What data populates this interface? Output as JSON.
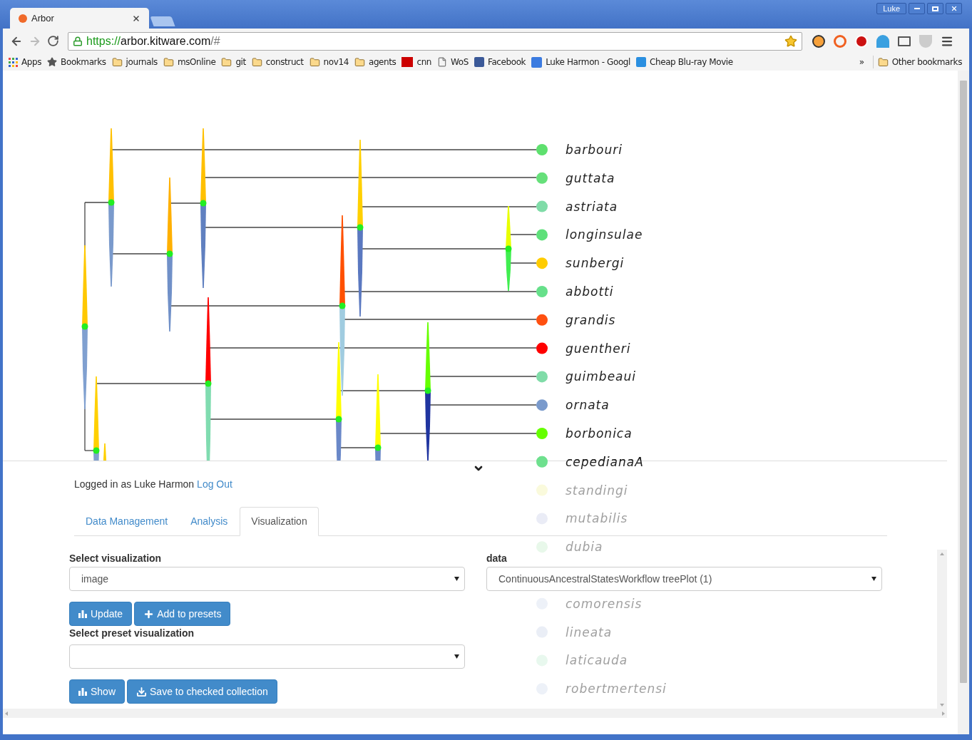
{
  "browser": {
    "tab_title": "Arbor",
    "profile": "Luke",
    "url_scheme": "https://",
    "url_host": "arbor.kitware.com",
    "url_path": "/#"
  },
  "bookmarks": [
    {
      "label": "Apps",
      "kind": "apps"
    },
    {
      "label": "Bookmarks",
      "kind": "star"
    },
    {
      "label": "journals",
      "kind": "folder"
    },
    {
      "label": "msOnline",
      "kind": "folder"
    },
    {
      "label": "git",
      "kind": "folder"
    },
    {
      "label": "construct",
      "kind": "folder"
    },
    {
      "label": "nov14",
      "kind": "folder"
    },
    {
      "label": "agents",
      "kind": "folder"
    },
    {
      "label": "cnn",
      "kind": "news"
    },
    {
      "label": "WoS",
      "kind": "page"
    },
    {
      "label": "Facebook",
      "kind": "social"
    },
    {
      "label": "Luke Harmon - Googl",
      "kind": "search"
    },
    {
      "label": "Cheap Blu-ray Movie",
      "kind": "blog"
    }
  ],
  "bookmarks_overflow": "»",
  "other_bookmarks": "Other bookmarks",
  "tree": {
    "tips": [
      {
        "name": "barbouri",
        "color": "#5ee06e"
      },
      {
        "name": "guttata",
        "color": "#66e07a"
      },
      {
        "name": "astriata",
        "color": "#80dca8"
      },
      {
        "name": "longinsulae",
        "color": "#5ee07a"
      },
      {
        "name": "sunbergi",
        "color": "#ffcc00"
      },
      {
        "name": "abbotti",
        "color": "#66e08a"
      },
      {
        "name": "grandis",
        "color": "#ff5010"
      },
      {
        "name": "guentheri",
        "color": "#ff0000"
      },
      {
        "name": "guimbeaui",
        "color": "#80dca8"
      },
      {
        "name": "ornata",
        "color": "#7a9acc"
      },
      {
        "name": "borbonica",
        "color": "#66ff00"
      },
      {
        "name": "cepedianaA",
        "color": "#6ee08e"
      },
      {
        "name": "standingi",
        "color": "#fafadc"
      },
      {
        "name": "mutabilis",
        "color": "#eaecf6"
      },
      {
        "name": "dubia",
        "color": "#e8f8ea"
      },
      {
        "name": "comorensis",
        "color": "#edf1f8"
      },
      {
        "name": "lineata",
        "color": "#eaeef6"
      },
      {
        "name": "laticauda",
        "color": "#e8f8ee"
      },
      {
        "name": "robertmertensi",
        "color": "#edf1f8"
      }
    ]
  },
  "session": {
    "text": "Logged in as Luke Harmon",
    "link": "Log Out"
  },
  "tabs": [
    {
      "label": "Data Management",
      "selected": false
    },
    {
      "label": "Analysis",
      "selected": false
    },
    {
      "label": "Visualization",
      "selected": true
    }
  ],
  "form": {
    "fields": [
      {
        "label": "Select visualization",
        "value": "image"
      },
      {
        "label": "data",
        "value": "ContinuousAncestralStatesWorkflow treePlot (1)"
      }
    ],
    "actions": [
      {
        "label": "Update",
        "kind": "chart"
      },
      {
        "label": "Add to presets",
        "kind": "plus"
      }
    ],
    "preset": {
      "label": "Select preset visualization"
    },
    "preset_actions": [
      {
        "label": "Show",
        "kind": "chart"
      },
      {
        "label": "Save to checked collection",
        "kind": "download"
      }
    ]
  }
}
